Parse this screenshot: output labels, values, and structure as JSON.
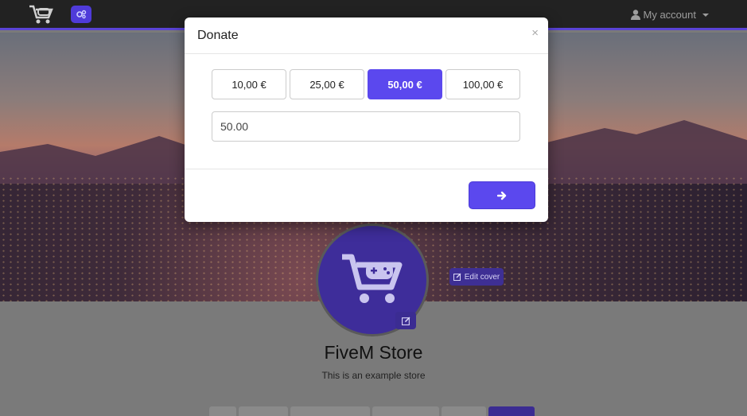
{
  "navbar": {
    "logo_icon": "cart-gamepad-icon",
    "badge_icon": "gears-icon",
    "account_icon": "user-icon",
    "account_label": "My account"
  },
  "cover": {
    "edit_label": "Edit cover"
  },
  "store": {
    "name": "FiveM Store",
    "description": "This is an example store"
  },
  "modal": {
    "title": "Donate",
    "close_label": "×",
    "amounts": [
      "10,00 €",
      "25,00 €",
      "50,00 €",
      "100,00 €"
    ],
    "selected_index": 2,
    "input_value": "50.00",
    "submit_icon": "arrow-right-icon"
  },
  "colors": {
    "accent": "#5b48ee",
    "navbar": "#222222",
    "avatar": "#3e2d9a"
  }
}
